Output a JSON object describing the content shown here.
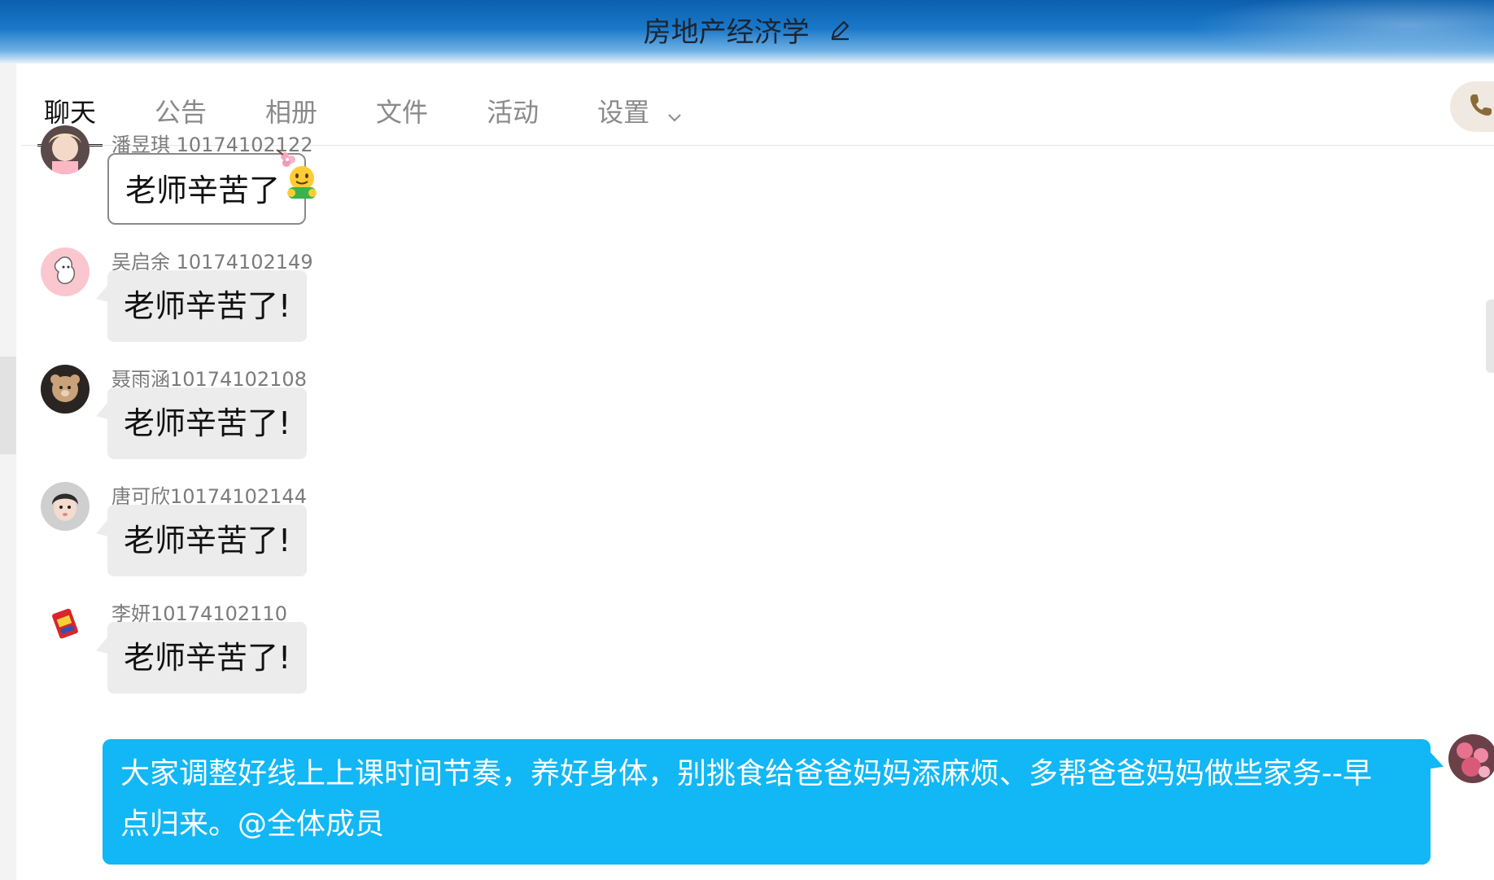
{
  "window": {
    "title": "房地产经济学"
  },
  "tabs": [
    {
      "label": "聊天",
      "active": true
    },
    {
      "label": "公告",
      "active": false
    },
    {
      "label": "相册",
      "active": false
    },
    {
      "label": "文件",
      "active": false
    },
    {
      "label": "活动",
      "active": false
    },
    {
      "label": "设置",
      "active": false,
      "has_dropdown": true
    }
  ],
  "messages": [
    {
      "sender": "潘昱琪 10174102122",
      "text": "老师辛苦了",
      "emoji": "face-with-hands-emoji",
      "style": "outlined"
    },
    {
      "sender": "吴启余 10174102149",
      "text": "老师辛苦了!"
    },
    {
      "sender": "聂雨涵10174102108",
      "text": "老师辛苦了!"
    },
    {
      "sender": "唐可欣10174102144",
      "text": "老师辛苦了!"
    },
    {
      "sender": "李妍10174102110",
      "text": "老师辛苦了!"
    }
  ],
  "own_message": {
    "text_line1": "大家调整好线上上课时间节奏，养好身体，别挑食给爸爸妈妈添麻烦、多帮爸爸妈妈做些家务--早",
    "text_line2": "点归来。@全体成员"
  },
  "icons": {
    "edit": "pencil-icon",
    "call": "phone-icon",
    "dropdown": "chevron-down-icon"
  },
  "colors": {
    "own_bubble": "#12b7f5",
    "other_bubble": "#ececec",
    "titlebar": "#1a78c9",
    "call_icon": "#8b6a3a"
  }
}
